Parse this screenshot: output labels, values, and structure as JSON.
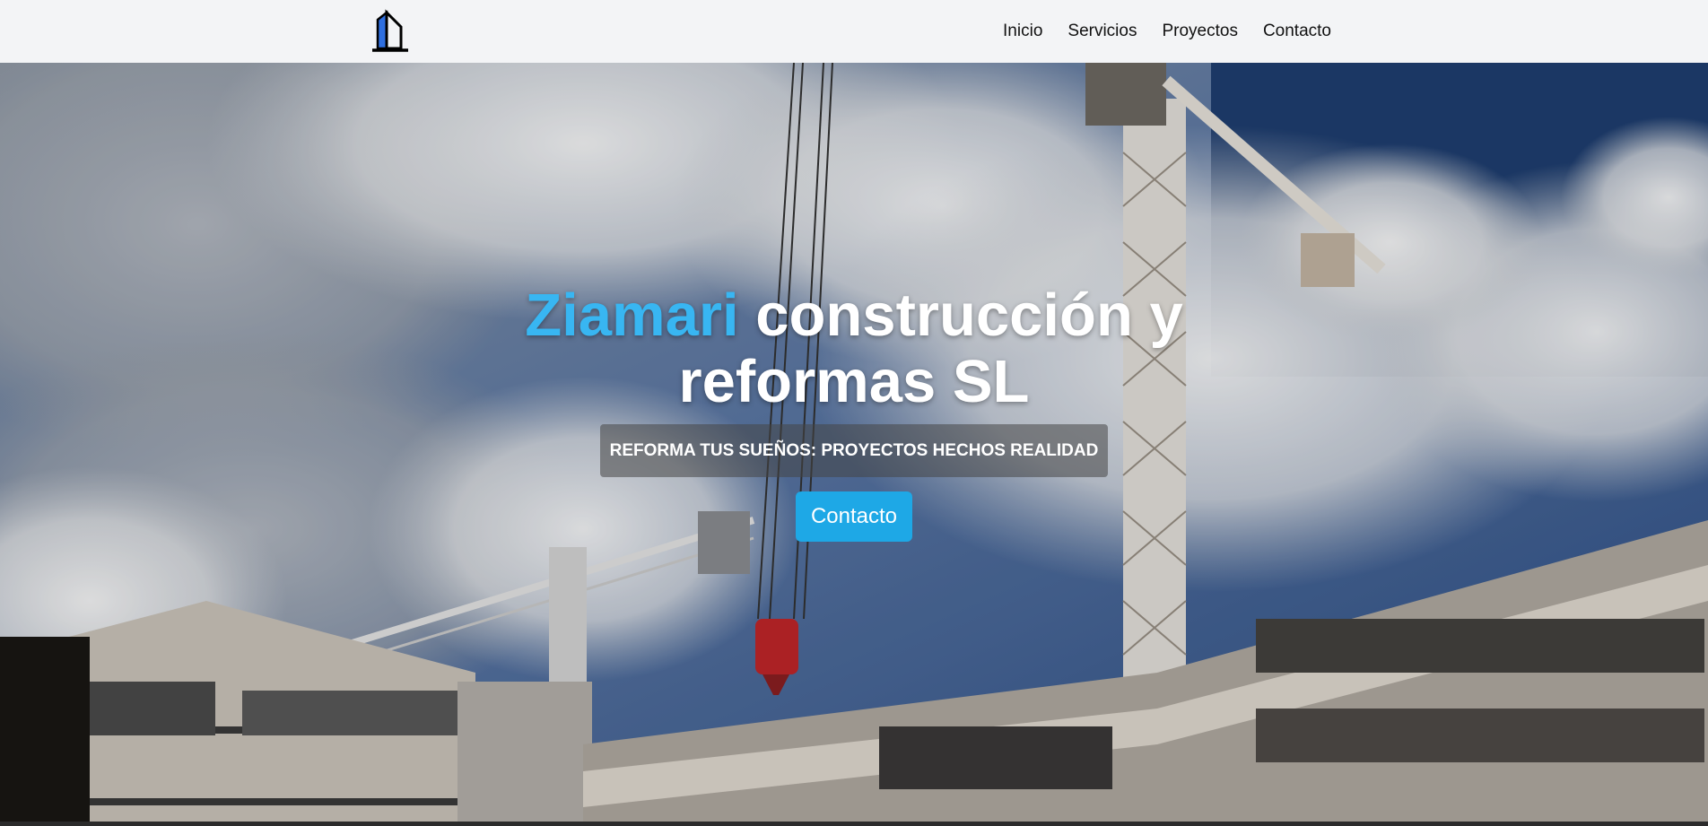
{
  "header": {
    "logo_icon": "building-icon",
    "nav": [
      {
        "label": "Inicio"
      },
      {
        "label": "Servicios"
      },
      {
        "label": "Proyectos"
      },
      {
        "label": "Contacto"
      }
    ]
  },
  "hero": {
    "title_brand": "Ziamari",
    "title_rest_line1": "construcción y",
    "title_line2": "reformas SL",
    "tagline": "REFORMA TUS SUEÑOS: PROYECTOS HECHOS REALIDAD",
    "cta_label": "Contacto",
    "background": "construction-site-photo"
  },
  "colors": {
    "accent": "#38b6f2",
    "button": "#1ea8e6",
    "nav_bg": "#f3f4f6"
  }
}
